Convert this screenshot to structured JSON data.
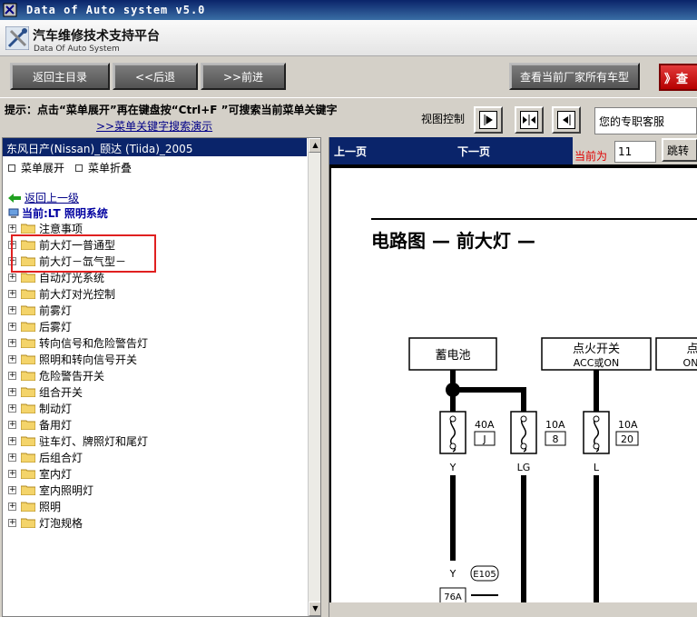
{
  "window": {
    "title": "Data of Auto system v5.0"
  },
  "header": {
    "title_cn": "汽车维修技术支持平台",
    "title_en": "Data Of Auto System"
  },
  "toolbar": {
    "home_label": "返回主目录",
    "back_label": "<<后退",
    "forward_label": ">>前进",
    "all_models_label": "查看当前厂家所有车型",
    "query_label": "》查"
  },
  "hint": {
    "text": "提示：点击“菜单展开”再在键盘按“Ctrl+F ”可搜索当前菜单关键字",
    "demo_link": ">>菜单关键字搜索演示",
    "view_control_label": "视图控制",
    "service_text": "您的专职客服"
  },
  "left": {
    "vehicle": "东风日产(Nissan)_颐达 (Tiida)_2005",
    "expand_label": "菜单展开",
    "collapse_label": "菜单折叠",
    "back_up_label": "返回上一级",
    "current_label": "当前:LT 照明系统",
    "tree": [
      "注意事项",
      "前大灯一普通型",
      "前大灯－氙气型－",
      "自动灯光系统",
      "前大灯对光控制",
      "前雾灯",
      "后雾灯",
      "转向信号和危险警告灯",
      "照明和转向信号开关",
      "危险警告开关",
      "组合开关",
      "制动灯",
      "备用灯",
      "驻车灯、牌照灯和尾灯",
      "后组合灯",
      "室内灯",
      "室内照明灯",
      "照明",
      "灯泡规格"
    ]
  },
  "right": {
    "prev_label": "上一页",
    "next_label": "下一页",
    "current_page_label": "当前为",
    "current_page": "11",
    "jump_label": "跳转",
    "diagram": {
      "title": "电路图 — 前大灯 —",
      "battery": "蓄电池",
      "ignition": "点火开关",
      "ignition_sub": "ACC或ON",
      "third_label": "点",
      "third_sub": "ON",
      "fuses": [
        {
          "amp": "40A",
          "num": "J",
          "wire": "Y"
        },
        {
          "amp": "10A",
          "num": "8",
          "wire": "LG"
        },
        {
          "amp": "10A",
          "num": "20",
          "wire": "L"
        }
      ],
      "connector": "76A",
      "connector_ref": "E105",
      "bottom_wire": "Y"
    }
  }
}
